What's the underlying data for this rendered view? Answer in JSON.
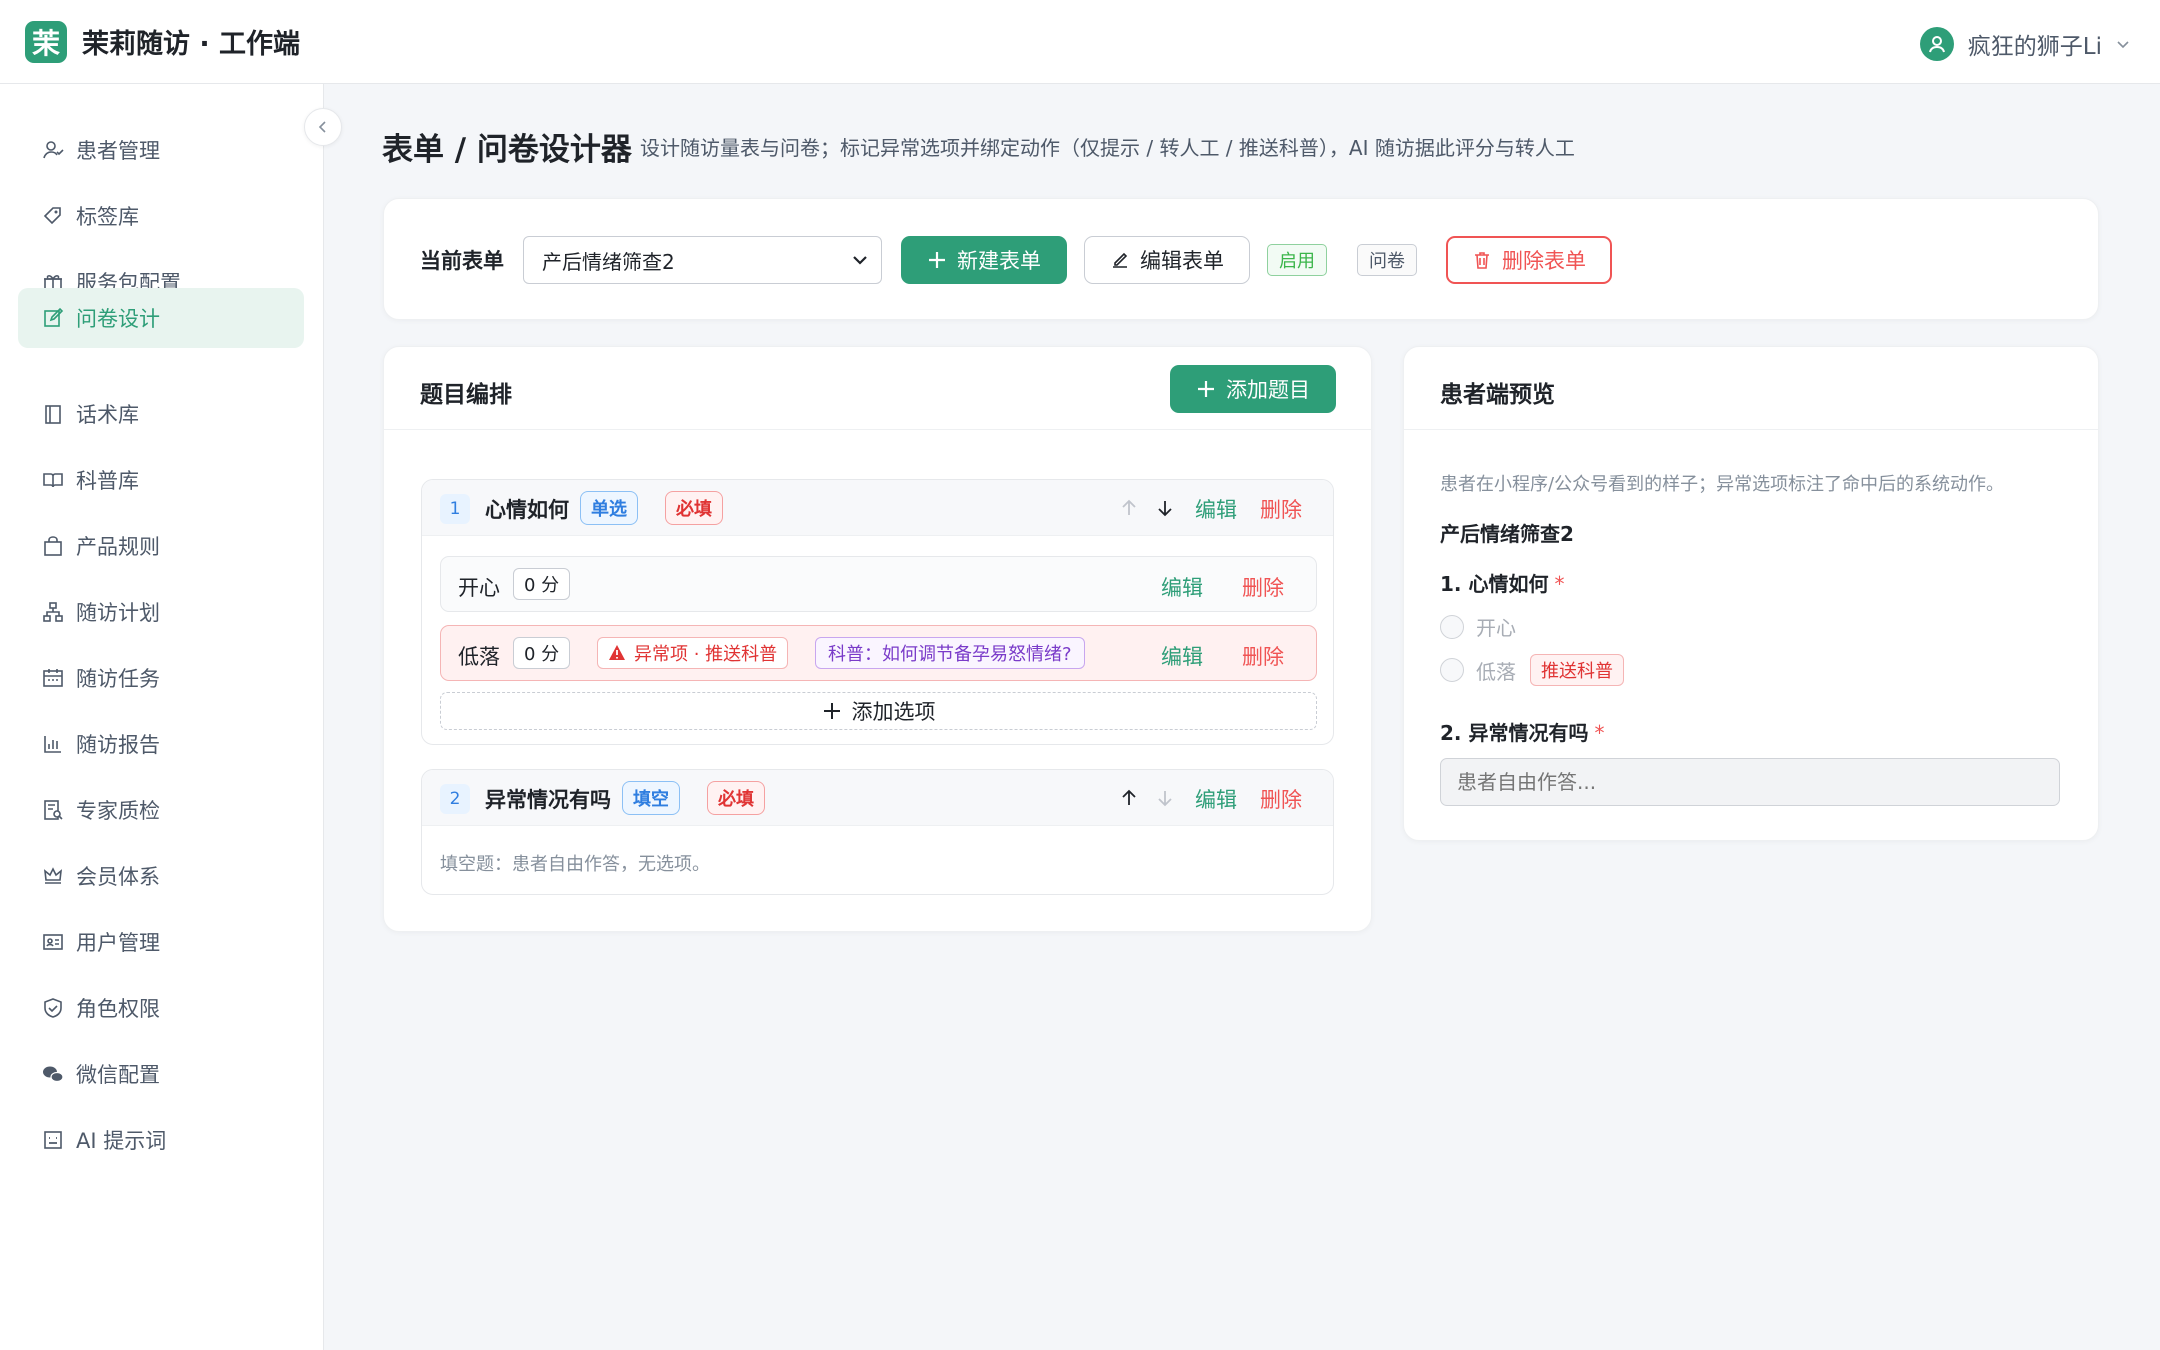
{
  "app": {
    "logo_char": "茉",
    "title": "茉莉随访 · 工作端"
  },
  "user": {
    "name": "疯狂的狮子Li"
  },
  "sidebar": {
    "items": [
      {
        "label": "患者管理",
        "icon": "patient-icon"
      },
      {
        "label": "标签库",
        "icon": "tag-icon"
      },
      {
        "label": "服务包配置",
        "icon": "gift-icon"
      },
      {
        "label": "问卷设计",
        "icon": "edit-icon",
        "active": true
      },
      {
        "label": "话术库",
        "icon": "book-icon"
      },
      {
        "label": "科普库",
        "icon": "open-book-icon"
      },
      {
        "label": "产品规则",
        "icon": "bag-icon"
      },
      {
        "label": "随访计划",
        "icon": "org-chart-icon"
      },
      {
        "label": "随访任务",
        "icon": "calendar-icon"
      },
      {
        "label": "随访报告",
        "icon": "bar-chart-icon"
      },
      {
        "label": "专家质检",
        "icon": "inspect-icon"
      },
      {
        "label": "会员体系",
        "icon": "crown-icon"
      },
      {
        "label": "用户管理",
        "icon": "id-card-icon"
      },
      {
        "label": "角色权限",
        "icon": "shield-icon"
      },
      {
        "label": "微信配置",
        "icon": "wechat-icon"
      },
      {
        "label": "AI 提示词",
        "icon": "robot-icon"
      }
    ]
  },
  "page": {
    "title": "表单 / 问卷设计器",
    "description": "设计随访量表与问卷；标记异常选项并绑定动作（仅提示 / 转人工 / 推送科普），AI 随访据此评分与转人工"
  },
  "form_bar": {
    "label": "当前表单",
    "selected": "产后情绪筛查2",
    "new_btn": "新建表单",
    "edit_btn": "编辑表单",
    "status_tag": "启用",
    "type_tag": "问卷",
    "delete_btn": "删除表单"
  },
  "editor": {
    "title": "题目编排",
    "add_btn": "添加题目",
    "edit_link": "编辑",
    "delete_link": "删除",
    "questions": [
      {
        "num": "1",
        "title": "心情如何",
        "type": "单选",
        "required": "必填",
        "options": [
          {
            "label": "开心",
            "score": "0 分"
          },
          {
            "label": "低落",
            "score": "0 分",
            "abnormal": "异常项 · 推送科普",
            "science": "科普：如何调节备孕易怒情绪?"
          }
        ],
        "add_option": "添加选项"
      },
      {
        "num": "2",
        "title": "异常情况有吗",
        "type": "填空",
        "required": "必填",
        "note": "填空题：患者自由作答，无选项。"
      }
    ]
  },
  "preview": {
    "title": "患者端预览",
    "description": "患者在小程序/公众号看到的样子；异常选项标注了命中后的系统动作。",
    "form_name": "产后情绪筛查2",
    "q1": "1. 心情如何",
    "q1_options": [
      "开心",
      "低落"
    ],
    "q1_action_tag": "推送科普",
    "q2": "2. 异常情况有吗",
    "q2_placeholder": "患者自由作答...",
    "required_mark": "*"
  },
  "colors": {
    "brand": "#2e9e78",
    "danger": "#f05454",
    "info": "#2f7ee0"
  }
}
